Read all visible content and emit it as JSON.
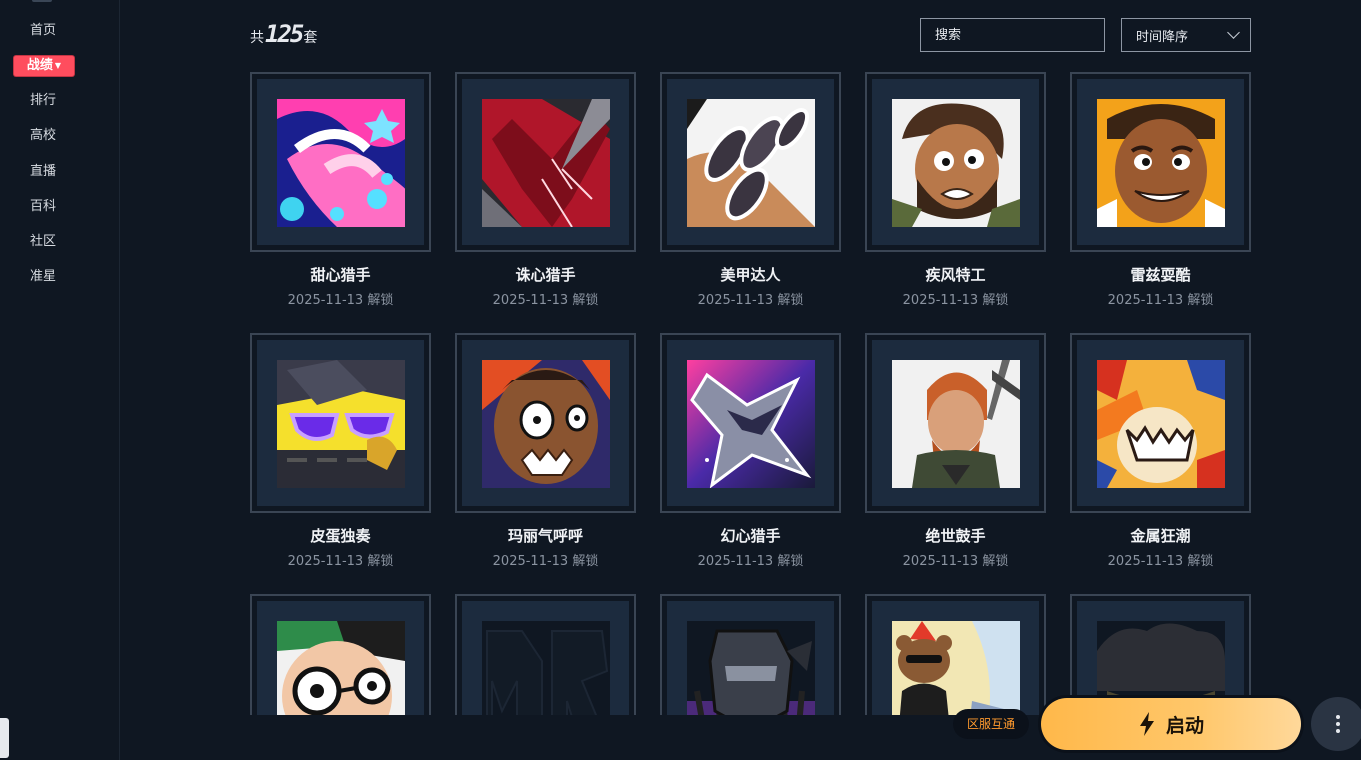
{
  "sidebar": {
    "items": [
      {
        "label": "首页",
        "active": false
      },
      {
        "label": "战绩",
        "active": true
      },
      {
        "label": "排行",
        "active": false
      },
      {
        "label": "高校",
        "active": false
      },
      {
        "label": "直播",
        "active": false
      },
      {
        "label": "百科",
        "active": false
      },
      {
        "label": "社区",
        "active": false
      },
      {
        "label": "准星",
        "active": false
      }
    ]
  },
  "header": {
    "count_prefix": "共",
    "count_value": "125",
    "count_suffix": "套",
    "search_placeholder": "搜索",
    "sort_label": "时间降序"
  },
  "cards": [
    {
      "name": "甜心猎手",
      "date": "2025-11-13 解锁",
      "art": "candy"
    },
    {
      "name": "诛心猎手",
      "date": "2025-11-13 解锁",
      "art": "red-heart"
    },
    {
      "name": "美甲达人",
      "date": "2025-11-13 解锁",
      "art": "nails"
    },
    {
      "name": "疾风特工",
      "date": "2025-11-13 解锁",
      "art": "agent-man"
    },
    {
      "name": "雷兹耍酷",
      "date": "2025-11-13 解锁",
      "art": "raze"
    },
    {
      "name": "皮蛋独奏",
      "date": "2025-11-13 解锁",
      "art": "sunglasses"
    },
    {
      "name": "玛丽气呼呼",
      "date": "2025-11-13 解锁",
      "art": "angry-face"
    },
    {
      "name": "幻心猎手",
      "date": "2025-11-13 解锁",
      "art": "star"
    },
    {
      "name": "绝世鼓手",
      "date": "2025-11-13 解锁",
      "art": "drummer"
    },
    {
      "name": "金属狂潮",
      "date": "2025-11-13 解锁",
      "art": "metal"
    },
    {
      "name": "",
      "date": "",
      "art": "glasses-kid"
    },
    {
      "name": "",
      "date": "",
      "art": "logo-dark"
    },
    {
      "name": "",
      "date": "",
      "art": "robot"
    },
    {
      "name": "",
      "date": "",
      "art": "bear"
    },
    {
      "name": "",
      "date": "",
      "art": "shadow-hair"
    }
  ],
  "footer": {
    "region_label": "区服互通",
    "launch_label": "启动",
    "launch_icon": "lightning-icon",
    "more_icon": "more-vertical-icon"
  },
  "colors": {
    "background": "#0f1722",
    "active_nav": "#ff4d5e",
    "launch_gradient_start": "#ffb84a",
    "region_text": "#ff9a2e"
  }
}
